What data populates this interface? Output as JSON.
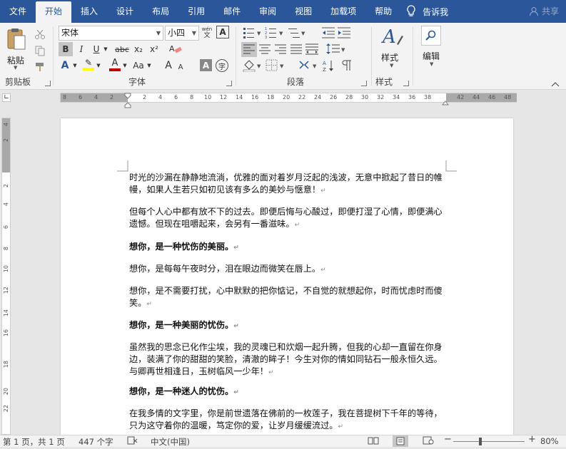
{
  "tabs": [
    "文件",
    "开始",
    "插入",
    "设计",
    "布局",
    "引用",
    "邮件",
    "审阅",
    "视图",
    "加载项",
    "帮助"
  ],
  "tell_me": "告诉我",
  "share": "共享",
  "clipboard": {
    "paste_label": "粘贴",
    "group_label": "剪贴板"
  },
  "font": {
    "name": "宋体",
    "size": "小四",
    "group_label": "字体",
    "phonetic": "wén",
    "bold": "B",
    "italic": "I",
    "underline": "U",
    "strike": "abc",
    "subscript": "x₂",
    "superscript": "x²",
    "grow": "A",
    "shrink": "A",
    "case": "Aa",
    "char_shade": "A",
    "enclose": "字"
  },
  "paragraph": {
    "group_label": "段落"
  },
  "styles": {
    "label": "样式",
    "group_label": "样式"
  },
  "editing": {
    "label": "编辑"
  },
  "ruler": {
    "h_left": [
      "8",
      "6",
      "4",
      "2"
    ],
    "h_main": [
      "2",
      "4",
      "6",
      "8",
      "10",
      "12",
      "14",
      "16",
      "18",
      "20",
      "22",
      "24",
      "26",
      "28",
      "30",
      "32",
      "34",
      "36",
      "38"
    ],
    "h_right": [
      "42",
      "44",
      "46",
      "48"
    ],
    "v": [
      "4",
      "2",
      "2",
      "4",
      "6",
      "8",
      "10",
      "12",
      "14",
      "16",
      "18",
      "20",
      "22"
    ]
  },
  "document": {
    "paragraphs": [
      {
        "text": "时光的沙漏在静静地流淌，优雅的面对着岁月泛起的浅波，无意中掀起了昔日的帷幔，如果人生若只如初见该有多么的美妙与惬意！",
        "bold": false
      },
      {
        "text": "但每个人心中都有放不下的过去。即便后悔与心酸过，即便打湿了心情，即便满心遗憾。但现在咀嚼起来，会另有一番滋味。",
        "bold": false
      },
      {
        "text": "想你，是一种忧伤的美丽。",
        "bold": true
      },
      {
        "text": "想你，是每每午夜时分，泪在眼边而微笑在唇上。",
        "bold": false
      },
      {
        "text": "想你，是不需要打扰，心中默默的把你惦记，不自觉的就想起你，时而忧虑时而傻笑。",
        "bold": false
      },
      {
        "text": "想你，是一种美丽的忧伤。",
        "bold": true
      },
      {
        "text": "虽然我的思念已化作尘埃，我的灵魂已和炊烟一起升腾，但我的心却一直留在你身边，装满了你的甜甜的笑脸，清澈的眸子！今生对你的情如同钻石一般永恒久远。与卿再世相逢日，玉树临风一少年！",
        "bold": false
      },
      {
        "text": "想你，是一种迷人的忧伤。",
        "bold": true
      },
      {
        "text": "在我多情的文字里，你是前世遗落在佛前的一枚莲子，我在菩提树下千年的等待，只为这守着你的温暖，笃定你的爱，让岁月缓缓流过。",
        "bold": false
      }
    ],
    "paragraph_mark": "↵"
  },
  "status": {
    "page": "第 1 页，共 1 页",
    "words": "447 个字",
    "language": "中文(中国)",
    "zoom": "80%"
  },
  "colors": {
    "accent": "#2b579a",
    "highlight": "#ffff00",
    "font_color": "#c00000"
  }
}
